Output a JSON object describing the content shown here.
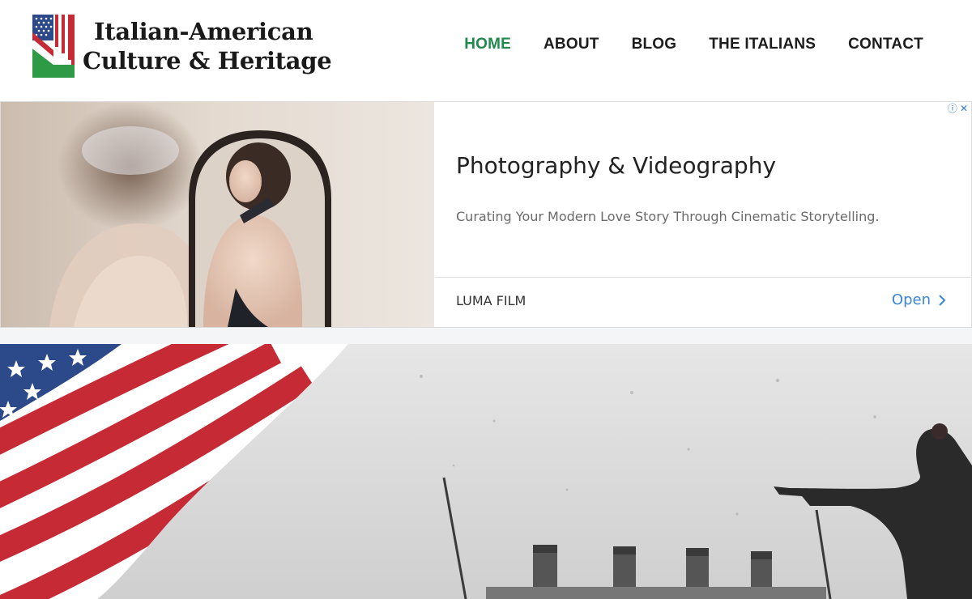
{
  "site": {
    "title_line1": "Italian-American",
    "title_line2": "Culture & Heritage",
    "logo_icon": "us-italy-flag-logo"
  },
  "nav": {
    "items": [
      {
        "label": "HOME",
        "active": true
      },
      {
        "label": "ABOUT",
        "active": false
      },
      {
        "label": "BLOG",
        "active": false
      },
      {
        "label": "THE ITALIANS",
        "active": false
      },
      {
        "label": "CONTACT",
        "active": false
      }
    ]
  },
  "ad": {
    "title": "Photography & Videography",
    "description": "Curating Your Modern Love Story Through Cinematic Storytelling.",
    "advertiser": "LUMA FILM",
    "cta": "Open",
    "info_icon": "ⓘ",
    "close_icon": "✕"
  },
  "colors": {
    "accent_green": "#1f8a4c",
    "link_blue": "#3a86d6",
    "flag_red": "#c62a35",
    "flag_blue": "#2c4a8a",
    "italy_green": "#2e9a45"
  }
}
